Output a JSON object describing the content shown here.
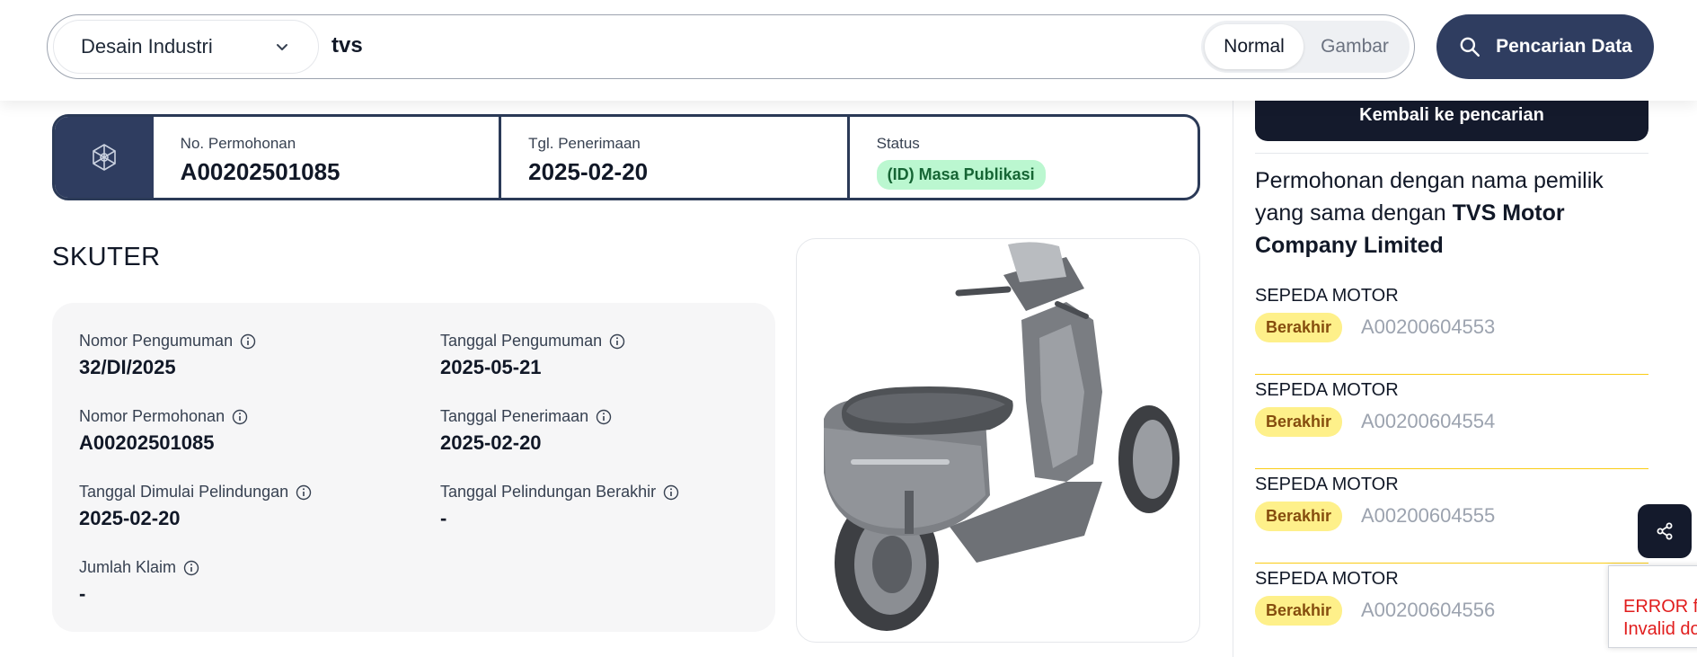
{
  "search": {
    "category": "Desain Industri",
    "query": "tvs",
    "mode_normal": "Normal",
    "mode_image": "Gambar",
    "submit_label": "Pencarian Data"
  },
  "application": {
    "number_label": "No. Permohonan",
    "number": "A00202501085",
    "received_label": "Tgl. Penerimaan",
    "received": "2025-02-20",
    "status_label": "Status",
    "status": "(ID) Masa Publikasi"
  },
  "design": {
    "title": "SKUTER",
    "fields": {
      "announcement_number_label": "Nomor Pengumuman",
      "announcement_number": "32/DI/2025",
      "announcement_date_label": "Tanggal Pengumuman",
      "announcement_date": "2025-05-21",
      "application_number_label": "Nomor Permohonan",
      "application_number": "A00202501085",
      "received_date_label": "Tanggal Penerimaan",
      "received_date": "2025-02-20",
      "protection_start_label": "Tanggal Dimulai Pelindungan",
      "protection_start": "2025-02-20",
      "protection_end_label": "Tanggal Pelindungan Berakhir",
      "protection_end": "-",
      "claims_label": "Jumlah Klaim",
      "claims": "-"
    }
  },
  "sidebar": {
    "back_label": "Kembali ke pencarian",
    "owner_prefix": "Permohonan dengan nama pemilik yang sama dengan",
    "owner_name": "TVS Motor Company Limited",
    "related": [
      {
        "name": "SEPEDA MOTOR",
        "status": "Berakhir",
        "number": "A00200604553"
      },
      {
        "name": "SEPEDA MOTOR",
        "status": "Berakhir",
        "number": "A00200604554"
      },
      {
        "name": "SEPEDA MOTOR",
        "status": "Berakhir",
        "number": "A00200604555"
      },
      {
        "name": "SEPEDA MOTOR",
        "status": "Berakhir",
        "number": "A00200604556"
      }
    ]
  },
  "error": {
    "line1": "ERROR fo",
    "line2": "Invalid do"
  },
  "colors": {
    "primary": "#2f3d60",
    "dark": "#141a2c",
    "status_published_bg": "#bbf7d0",
    "status_expired_bg": "#fef08a"
  }
}
